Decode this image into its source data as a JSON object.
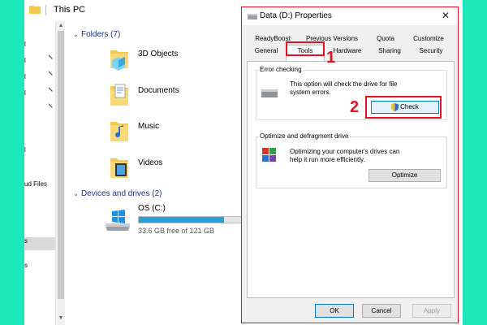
{
  "explorer": {
    "title": "This PC",
    "nav_items": [
      "l",
      "l",
      "l",
      "l",
      "l",
      "ud Files",
      "s",
      "s"
    ],
    "folders_header": "Folders (7)",
    "folders": [
      {
        "name": "3D Objects",
        "icon": "3d-objects-folder-icon"
      },
      {
        "name": "Documents",
        "icon": "documents-folder-icon"
      },
      {
        "name": "Music",
        "icon": "music-folder-icon"
      },
      {
        "name": "Videos",
        "icon": "videos-folder-icon"
      }
    ],
    "devices_header": "Devices and drives (2)",
    "drive": {
      "name": "OS (C:)",
      "free_text": "33.6 GB free of 121 GB",
      "used_fraction": 0.72
    }
  },
  "dialog": {
    "title": "Data (D:) Properties",
    "close_glyph": "✕",
    "tabs_top": [
      "ReadyBoost",
      "Previous Versions",
      "Quota",
      "Customize"
    ],
    "tabs_bottom": [
      "General",
      "Tools",
      "Hardware",
      "Sharing",
      "Security"
    ],
    "active_tab": "Tools",
    "error_checking": {
      "label": "Error checking",
      "text": "This option will check the drive for file system errors.",
      "button": "Check"
    },
    "optimize": {
      "label": "Optimize and defragment drive",
      "text": "Optimizing your computer's drives can help it run more efficiently.",
      "button": "Optimize"
    },
    "footer": {
      "ok": "OK",
      "cancel": "Cancel",
      "apply": "Apply"
    }
  },
  "annotations": {
    "step1": "1",
    "step2": "2"
  },
  "colors": {
    "background": "#1ee8b9",
    "highlight": "#e81123",
    "accent": "#0078d7",
    "drive_bar": "#26a0da"
  }
}
